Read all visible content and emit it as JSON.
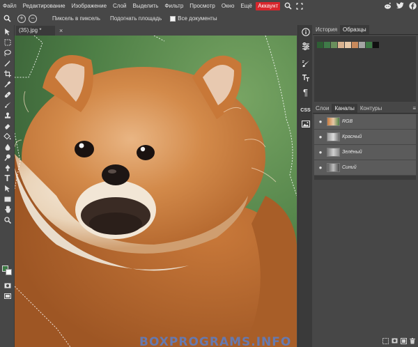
{
  "menu": {
    "items": [
      "Файл",
      "Редактирование",
      "Изображение",
      "Слой",
      "Выделить",
      "Фильтр",
      "Просмотр",
      "Окно",
      "Ещё"
    ],
    "account_label": "Аккаунт"
  },
  "options": {
    "pixel_label": "Пиксель в пиксель",
    "fit_label": "Подогнать площадь",
    "all_docs_label": "Все документы"
  },
  "document": {
    "tab_title": "(35).jpg *",
    "close": "×"
  },
  "history_panel": {
    "tabs": [
      "История",
      "Образцы"
    ],
    "swatches": [
      "#2e5e34",
      "#3f7a48",
      "#6a8f5c",
      "#d9b28f",
      "#e8c9a8",
      "#c98a5c",
      "#a5a5a5",
      "#3d7a45",
      "#101010"
    ]
  },
  "layers_panel": {
    "tabs": [
      "Слои",
      "Каналы",
      "Контуры"
    ],
    "channels": [
      {
        "name": "RGB"
      },
      {
        "name": "Красный"
      },
      {
        "name": "Зелёный"
      },
      {
        "name": "Синий"
      }
    ]
  },
  "side_buttons": {
    "css_label": "CSS"
  },
  "colors": {
    "foreground": "#3d7a45",
    "background": "#ffffff",
    "accent": "#d8262c"
  },
  "watermark": "BOXPROGRAMS.INFO"
}
